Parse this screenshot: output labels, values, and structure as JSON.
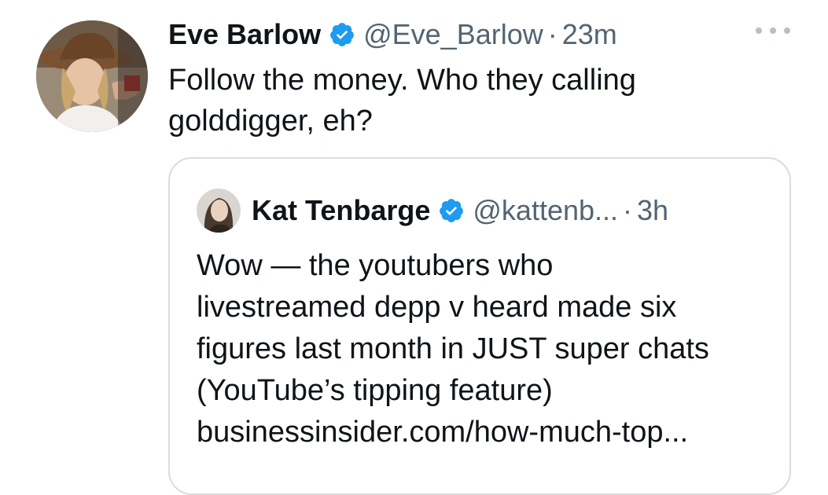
{
  "tweet": {
    "author_name": "Eve Barlow",
    "handle": "@Eve_Barlow",
    "separator": "·",
    "time": "23m",
    "text": "Follow the money. Who they calling golddigger, eh?",
    "avatar_icon": "user-avatar-photo",
    "more_icon": "more-options-icon"
  },
  "quoted_tweet": {
    "author_name": "Kat Tenbarge",
    "handle": "@kattenb...",
    "separator": "·",
    "time": "3h",
    "lines": [
      "Wow — the youtubers who",
      "livestreamed depp v heard made six",
      "figures last month in JUST super chats",
      "(YouTube’s tipping feature)",
      "businessinsider.com/how-much-top..."
    ],
    "avatar_icon": "user-avatar-photo"
  },
  "colors": {
    "primary_text": "#0f1419",
    "secondary_text": "#536471",
    "verified_blue": "#1d9bf0",
    "border": "#d6dde2"
  }
}
